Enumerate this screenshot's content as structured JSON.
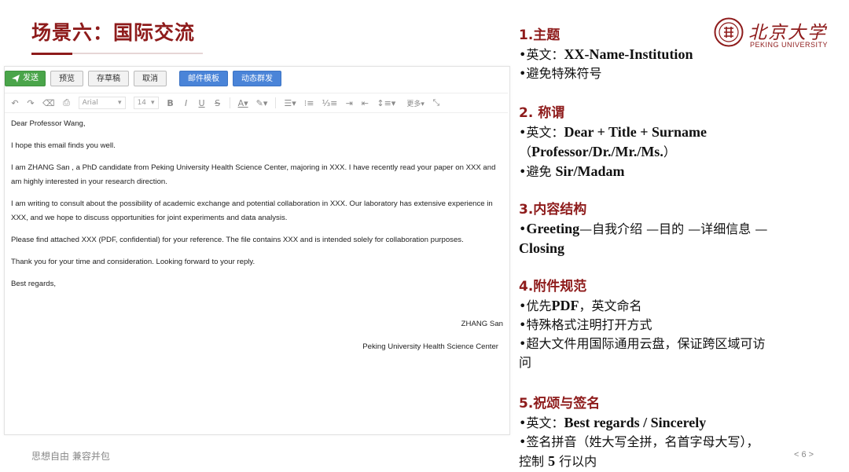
{
  "slide": {
    "title": "场景六：国际交流",
    "motto": "思想自由 兼容并包",
    "page_number": "< 6 >"
  },
  "logo": {
    "cn": "北京大学",
    "en": "PEKING UNIVERSITY"
  },
  "email": {
    "buttons": {
      "send": "发送",
      "preview": "预览",
      "save_draft": "存草稿",
      "cancel": "取消",
      "template": "邮件模板",
      "dynamic_group": "动态群发"
    },
    "toolbar": {
      "font": "Arial",
      "size": "14",
      "more": "更多"
    },
    "body": {
      "greeting": "Dear Professor Wang,",
      "line1": "I hope this email finds you well.",
      "para1": "I am ZHANG San , a PhD candidate from Peking University Health Science Center, majoring in XXX. I have recently read your paper on XXX and am highly interested in your research direction.",
      "para2": "I am writing to consult about the possibility of academic exchange and potential collaboration in XXX. Our laboratory has extensive experience in XXX, and we hope to discuss opportunities for joint experiments and data analysis.",
      "para3": "Please find attached XXX (PDF, confidential) for your reference. The file contains XXX and is intended solely for collaboration purposes.",
      "para4": "Thank you for your time and consideration. Looking forward to your reply.",
      "closing": "Best regards,",
      "signature_name": "ZHANG San",
      "signature_org": "Peking University Health Science Center"
    }
  },
  "sections": [
    {
      "head": "1.主题",
      "lines": [
        {
          "prefix": "•英文：",
          "bold": "XX-Name-Institution",
          "rest": ""
        },
        {
          "prefix": "•避免特殊符号",
          "bold": "",
          "rest": ""
        }
      ]
    },
    {
      "head": "2. 称谓",
      "lines": [
        {
          "prefix": "•英文：",
          "bold": "Dear + Title + Surname",
          "rest": ""
        },
        {
          "prefix": "（",
          "bold": "Professor/Dr./Mr./Ms.",
          "rest": "）"
        },
        {
          "prefix": "•避免 ",
          "bold": "Sir/Madam",
          "rest": ""
        }
      ]
    },
    {
      "head": "3.内容结构",
      "lines": [
        {
          "prefix": "•",
          "bold": "Greeting",
          "rest": "—自我介绍 —目的 —详细信息 —"
        },
        {
          "prefix": "",
          "bold": "Closing",
          "rest": ""
        }
      ]
    },
    {
      "head": "4.附件规范",
      "lines": [
        {
          "prefix": "•优先",
          "bold": "PDF",
          "rest": "，英文命名"
        },
        {
          "prefix": "•特殊格式注明打开方式",
          "bold": "",
          "rest": ""
        },
        {
          "prefix": "•超大文件用国际通用云盘，保证跨区域可访",
          "bold": "",
          "rest": ""
        },
        {
          "prefix": "问",
          "bold": "",
          "rest": ""
        }
      ]
    },
    {
      "head": "5.祝颂与签名",
      "lines": [
        {
          "prefix": "•英文：",
          "bold": "Best regards / Sincerely",
          "rest": ""
        },
        {
          "prefix": "•签名拼音（姓大写全拼，名首字母大写），",
          "bold": "",
          "rest": ""
        },
        {
          "prefix": "控制 ",
          "bold": "5",
          "rest": " 行以内"
        }
      ]
    }
  ],
  "colors": {
    "accent": "#8e1b1b",
    "send_button": "#4aa54a",
    "blue_button": "#4a84d8"
  }
}
